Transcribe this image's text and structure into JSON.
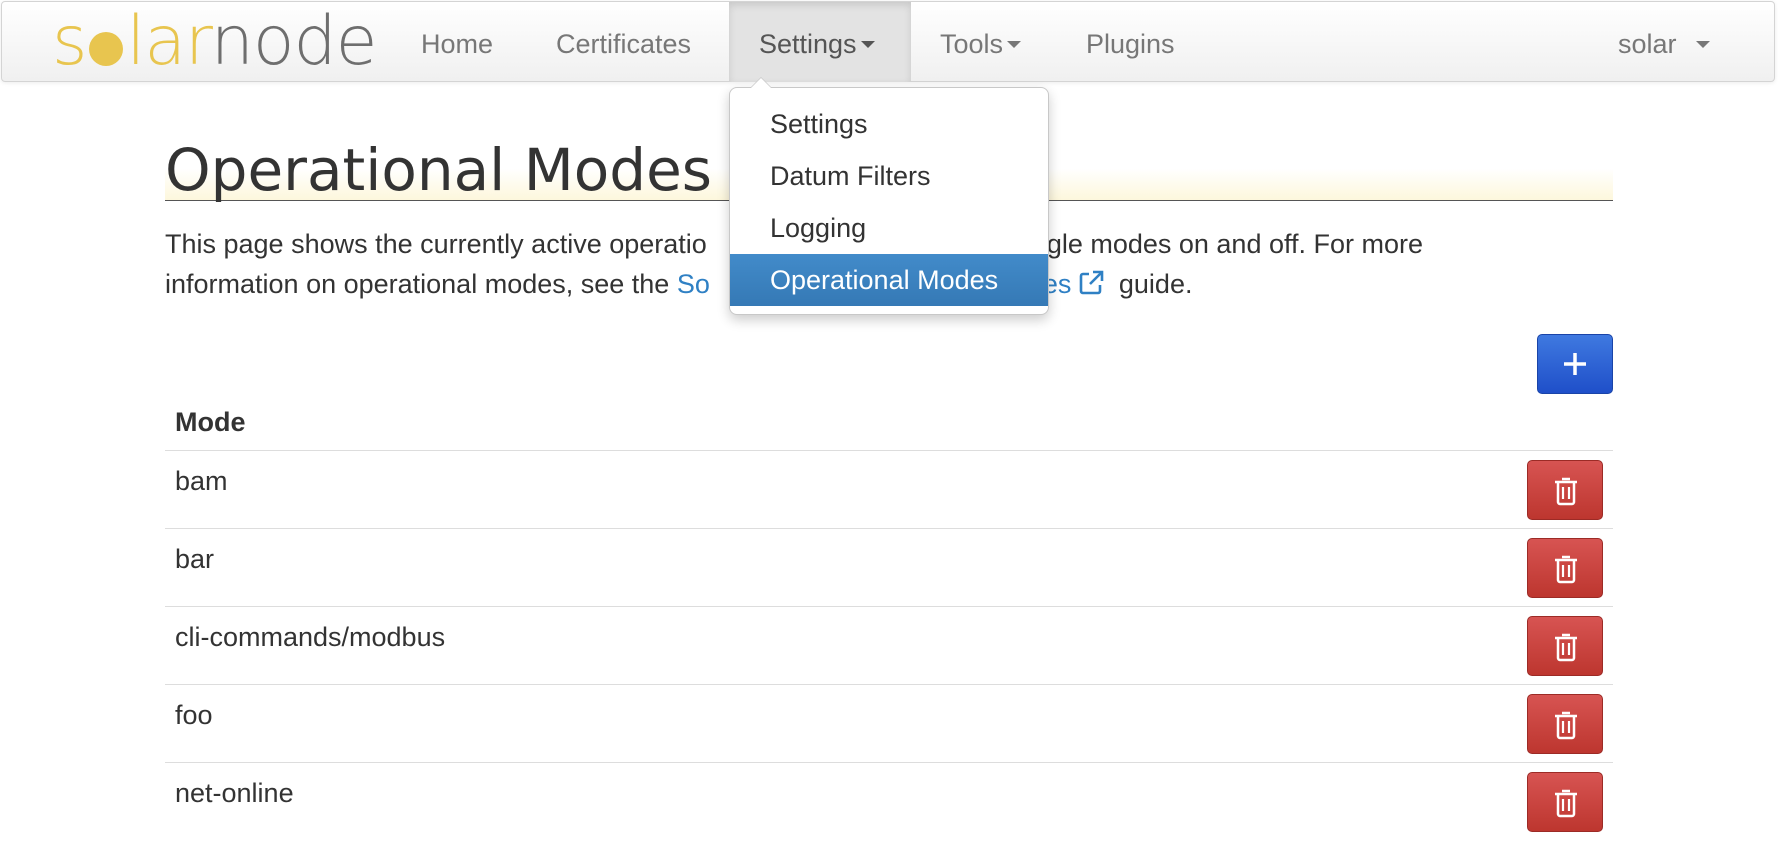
{
  "navbar": {
    "brand": {
      "part1": "s",
      "part2": "lar",
      "part3": "node"
    },
    "items": [
      {
        "label": "Home"
      },
      {
        "label": "Certificates"
      },
      {
        "label": "Settings"
      },
      {
        "label": "Tools"
      },
      {
        "label": "Plugins"
      }
    ],
    "user": "solar"
  },
  "dropdown": {
    "items": [
      {
        "label": "Settings"
      },
      {
        "label": "Datum Filters"
      },
      {
        "label": "Logging"
      },
      {
        "label": "Operational Modes"
      }
    ],
    "selected": "Operational Modes"
  },
  "page": {
    "title": "Operational Modes",
    "intro_line1_start": "This page shows the currently active operatio",
    "intro_line1_end": "oggle modes on and off. For more",
    "intro_line2_start": "information on operational modes, see the ",
    "intro_link_start": "So",
    "intro_link_end": "es",
    "intro_line2_end": " guide."
  },
  "table": {
    "header": "Mode",
    "rows": [
      {
        "mode": "bam"
      },
      {
        "mode": "bar"
      },
      {
        "mode": "cli-commands/modbus"
      },
      {
        "mode": "foo"
      },
      {
        "mode": "net-online"
      }
    ]
  },
  "icons": {
    "add": "plus-icon",
    "delete": "trash-icon",
    "external": "external-link-icon"
  },
  "colors": {
    "brand_yellow": "#e8c54f",
    "link": "#2f80c4",
    "selected": "#428bca",
    "add_button": "#2c5fd6",
    "delete_button": "#c9403b"
  }
}
